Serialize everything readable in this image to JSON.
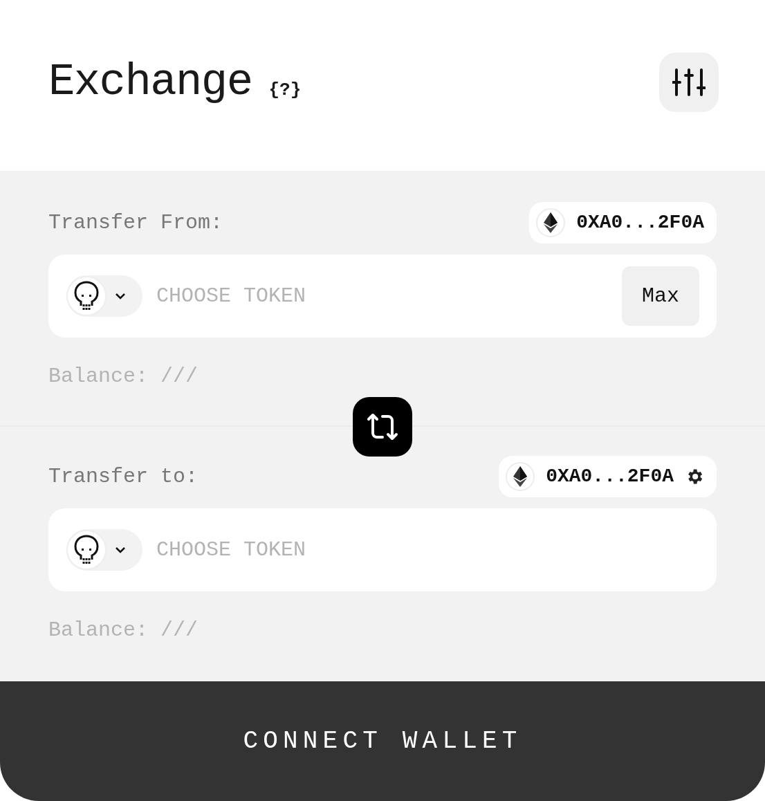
{
  "header": {
    "title": "Exchange",
    "help": "{?}"
  },
  "sections": [
    {
      "label": "Transfer From:",
      "wallet": {
        "address": "0XA0...2F0A",
        "settings": false
      },
      "token": {
        "placeholder": "CHOOSE TOKEN",
        "max": "Max"
      },
      "balance": "Balance: ///"
    },
    {
      "label": "Transfer to:",
      "wallet": {
        "address": "0XA0...2F0A",
        "settings": true
      },
      "token": {
        "placeholder": "CHOOSE TOKEN"
      },
      "balance": "Balance: ///"
    }
  ],
  "connect_button": "CONNECT WALLET"
}
